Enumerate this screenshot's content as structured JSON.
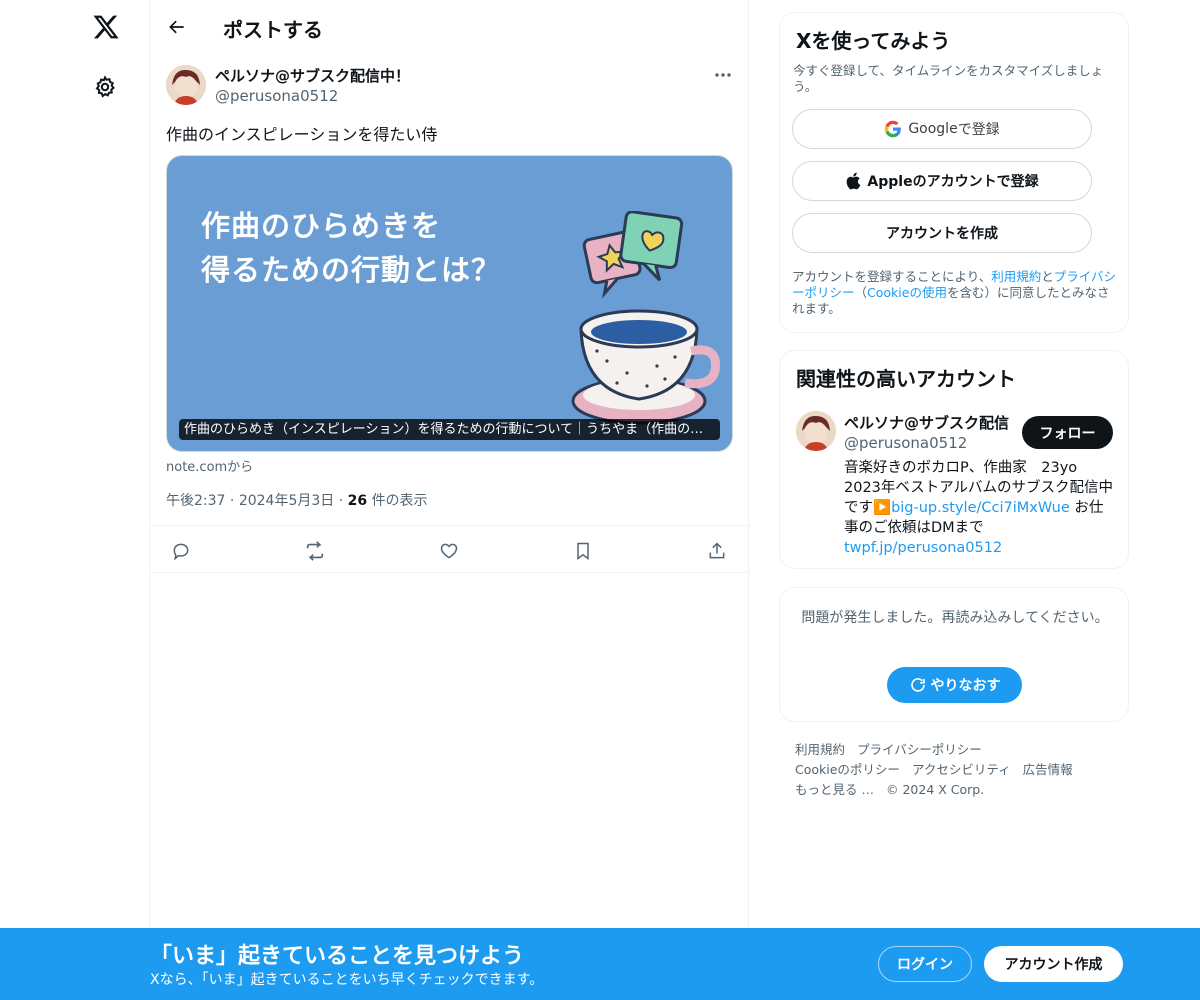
{
  "nav": {
    "logo_icon": "x-logo-icon",
    "settings_icon": "gear-icon"
  },
  "header": {
    "title": "ポストする",
    "back_icon": "arrow-left-icon"
  },
  "post": {
    "author_name": "ペルソナ@サブスク配信中！",
    "author_handle": "@perusona0512",
    "text": "作曲のインスピレーションを得たい侍",
    "card": {
      "headline": "作曲のひらめきを\n得るための行動とは？",
      "caption": "作曲のひらめき（インスピレーション）を得るための行動について｜うちやま（作曲の先…",
      "source": "note.comから",
      "bg_color": "#6a9dd4"
    },
    "time": "午後2:37",
    "date": "2024年5月3日",
    "view_count": "26",
    "view_label": "件の表示",
    "actions": [
      "reply-icon",
      "repost-icon",
      "like-icon",
      "bookmark-icon",
      "share-icon"
    ]
  },
  "signup": {
    "title": "Xを使ってみよう",
    "subtitle": "今すぐ登録して、タイムラインをカスタマイズしましょう。",
    "google_brand": "Google",
    "google_suffix": " で登録",
    "apple_label": "Appleのアカウントで登録",
    "create_label": "アカウントを作成",
    "legal_prefix": "アカウントを登録することにより、",
    "legal_terms": "利用規約",
    "legal_and": "と",
    "legal_privacy": "プライバシーポリシー",
    "legal_open": "（",
    "legal_cookie": "Cookieの使用",
    "legal_suffix": "を含む）に同意したとみなされます。"
  },
  "related": {
    "title": "関連性の高いアカウント",
    "name": "ペルソナ@サブスク配信",
    "handle": "@perusona0512",
    "follow_label": "フォロー",
    "bio_line1": "音楽好きのボカロP、作曲家　23yo",
    "bio_line2": "2023年ベストアルバムのサブスク配信中です",
    "bio_emoji": "▶️",
    "bio_link1": "big-up.style/Cci7iMxWue",
    "bio_line3": " お仕事のご依頼はDMまで",
    "bio_link2": "twpf.jp/perusona0512"
  },
  "error": {
    "text": "問題が発生しました。再読み込みしてください。",
    "retry_label": "やりなおす"
  },
  "footer": {
    "terms": "利用規約",
    "privacy": "プライバシーポリシー",
    "cookie": "Cookieのポリシー",
    "accessibility": "アクセシビリティ",
    "ads": "広告情報",
    "more": "もっと見る …",
    "copyright": "© 2024 X Corp."
  },
  "bottom_bar": {
    "title": "「いま」起きていることを見つけよう",
    "subtitle": "Xなら、「いま」起きていることをいち早くチェックできます。",
    "login_label": "ログイン",
    "signup_label": "アカウント作成"
  },
  "colors": {
    "accent": "#1d9bf0",
    "text": "#0f1419",
    "muted": "#536471"
  }
}
